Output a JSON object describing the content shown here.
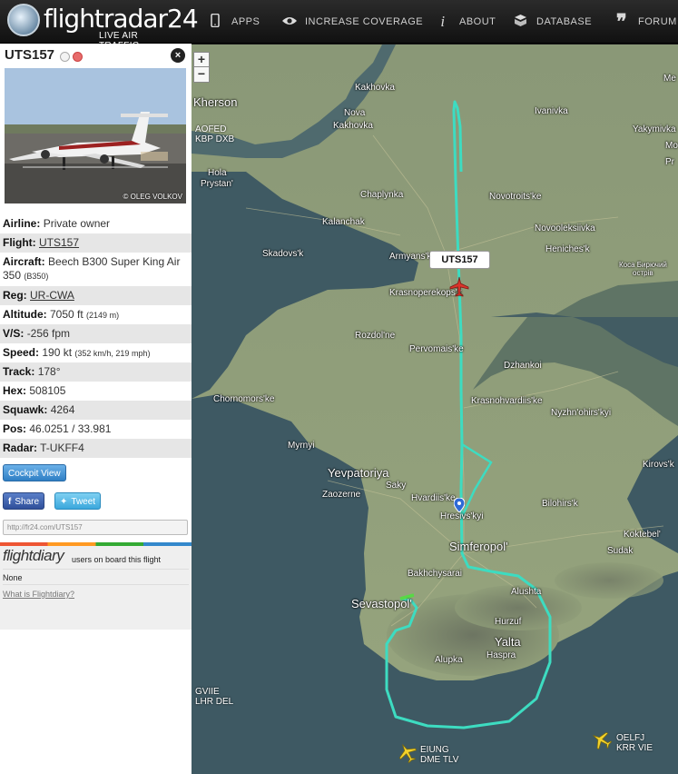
{
  "header": {
    "logo_text": "flightradar24",
    "logo_sub": "LIVE AIR TRAFFIC",
    "nav": [
      {
        "icon": "phone-icon",
        "label": "APPS"
      },
      {
        "icon": "eye-icon",
        "label": "INCREASE COVERAGE"
      },
      {
        "icon": "info-icon",
        "label": "ABOUT"
      },
      {
        "icon": "database-icon",
        "label": "DATABASE"
      },
      {
        "icon": "quote-icon",
        "label": "FORUM"
      }
    ]
  },
  "panel": {
    "callsign": "UTS157",
    "close_label": "×",
    "photo_credit": "© OLEG VOLKOV",
    "details": {
      "airline_label": "Airline:",
      "airline": "Private owner",
      "flight_label": "Flight:",
      "flight": "UTS157",
      "aircraft_label": "Aircraft:",
      "aircraft": "Beech B300 Super King Air 350",
      "aircraft_code": "(B350)",
      "reg_label": "Reg:",
      "reg": "UR-CWA",
      "altitude_label": "Altitude:",
      "altitude": "7050 ft",
      "altitude_m": "(2149 m)",
      "vs_label": "V/S:",
      "vs": "-256 fpm",
      "speed_label": "Speed:",
      "speed": "190 kt",
      "speed_alt": "(352 km/h, 219 mph)",
      "track_label": "Track:",
      "track": "178°",
      "hex_label": "Hex:",
      "hex": "508105",
      "squawk_label": "Squawk:",
      "squawk": "4264",
      "pos_label": "Pos:",
      "pos": "46.0251 / 33.981",
      "radar_label": "Radar:",
      "radar": "T-UKFF4"
    },
    "cockpit_view": "Cockpit View",
    "share": "Share",
    "tweet": "Tweet",
    "url": "http://fr24.com/UTS157",
    "flightdiary": {
      "logo": "flightdiary",
      "text": "users on board this flight",
      "none": "None",
      "link": "What is Flightdiary?"
    }
  },
  "map": {
    "zoom_in": "+",
    "zoom_out": "−",
    "flight_tag": "UTS157",
    "aircraft": [
      {
        "id": "ac-top",
        "line1": "AOFED",
        "line2": "KBP DXB"
      },
      {
        "id": "ac-left",
        "line1": "GVIIE",
        "line2": "LHR DEL"
      },
      {
        "id": "ac-bottom",
        "line1": "EIUNG",
        "line2": "DME TLV"
      },
      {
        "id": "ac-right",
        "line1": "OELFJ",
        "line2": "KRR VIE"
      }
    ],
    "places": [
      {
        "name": "Kakhovka"
      },
      {
        "name": "Kherson"
      },
      {
        "name": "Nova"
      },
      {
        "name": "Kakhovka"
      },
      {
        "name": "Ivanivka"
      },
      {
        "name": "Yakymivka"
      },
      {
        "name": "Hola"
      },
      {
        "name": "Prystan'"
      },
      {
        "name": "Chaplynka"
      },
      {
        "name": "Novotroits'ke"
      },
      {
        "name": "Kalanchak"
      },
      {
        "name": "Novooleksiivka"
      },
      {
        "name": "Skadovs'k"
      },
      {
        "name": "Armyans'k"
      },
      {
        "name": "Heniches'k"
      },
      {
        "name": "Коса Бирючий"
      },
      {
        "name": "острів"
      },
      {
        "name": "Krasnoperekops'k"
      },
      {
        "name": "Rozdol'ne"
      },
      {
        "name": "Pervomais'ke"
      },
      {
        "name": "Dzhankoi"
      },
      {
        "name": "Chornomors'ke"
      },
      {
        "name": "Krasnohvardiis'ke"
      },
      {
        "name": "Nyzhn'ohirs'kyi"
      },
      {
        "name": "Myrnyi"
      },
      {
        "name": "Yevpatoriya"
      },
      {
        "name": "Saky"
      },
      {
        "name": "Kirovs'k"
      },
      {
        "name": "Zaozerne"
      },
      {
        "name": "Hvardiis'ke"
      },
      {
        "name": "Hresivs'kyi"
      },
      {
        "name": "Bilohirs'k"
      },
      {
        "name": "Simferopol'"
      },
      {
        "name": "Koktebel'"
      },
      {
        "name": "Sudak"
      },
      {
        "name": "Bakhchysarai"
      },
      {
        "name": "Sevastopol'"
      },
      {
        "name": "Alushta"
      },
      {
        "name": "Hurzuf"
      },
      {
        "name": "Yalta"
      },
      {
        "name": "Alupka"
      },
      {
        "name": "Haspra"
      },
      {
        "name": "Me"
      },
      {
        "name": "Mo"
      },
      {
        "name": "Pr"
      }
    ]
  }
}
